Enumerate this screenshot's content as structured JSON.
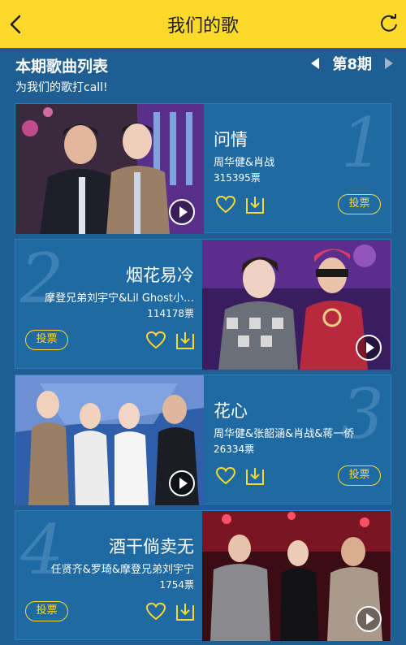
{
  "header": {
    "title": "我们的歌"
  },
  "section": {
    "title": "本期歌曲列表",
    "subtitle": "为我们的歌打call!",
    "period": "第8期"
  },
  "colors": {
    "accent": "#fcd92b",
    "background": "#1f5e92"
  },
  "songs": [
    {
      "rank": "1",
      "title": "问情",
      "artists": "周华健&肖战",
      "votes": "315395票",
      "vote_label": "投票"
    },
    {
      "rank": "2",
      "title": "烟花易冷",
      "artists": "摩登兄弟刘宇宁&Lil Ghost小…",
      "votes": "114178票",
      "vote_label": "投票"
    },
    {
      "rank": "3",
      "title": "花心",
      "artists": "周华健&张韶涵&肖战&蒋一侨",
      "votes": "26334票",
      "vote_label": "投票"
    },
    {
      "rank": "4",
      "title": "酒干倘卖无",
      "artists": "任贤齐&罗琦&摩登兄弟刘宇宁",
      "votes": "1754票",
      "vote_label": "投票"
    }
  ]
}
